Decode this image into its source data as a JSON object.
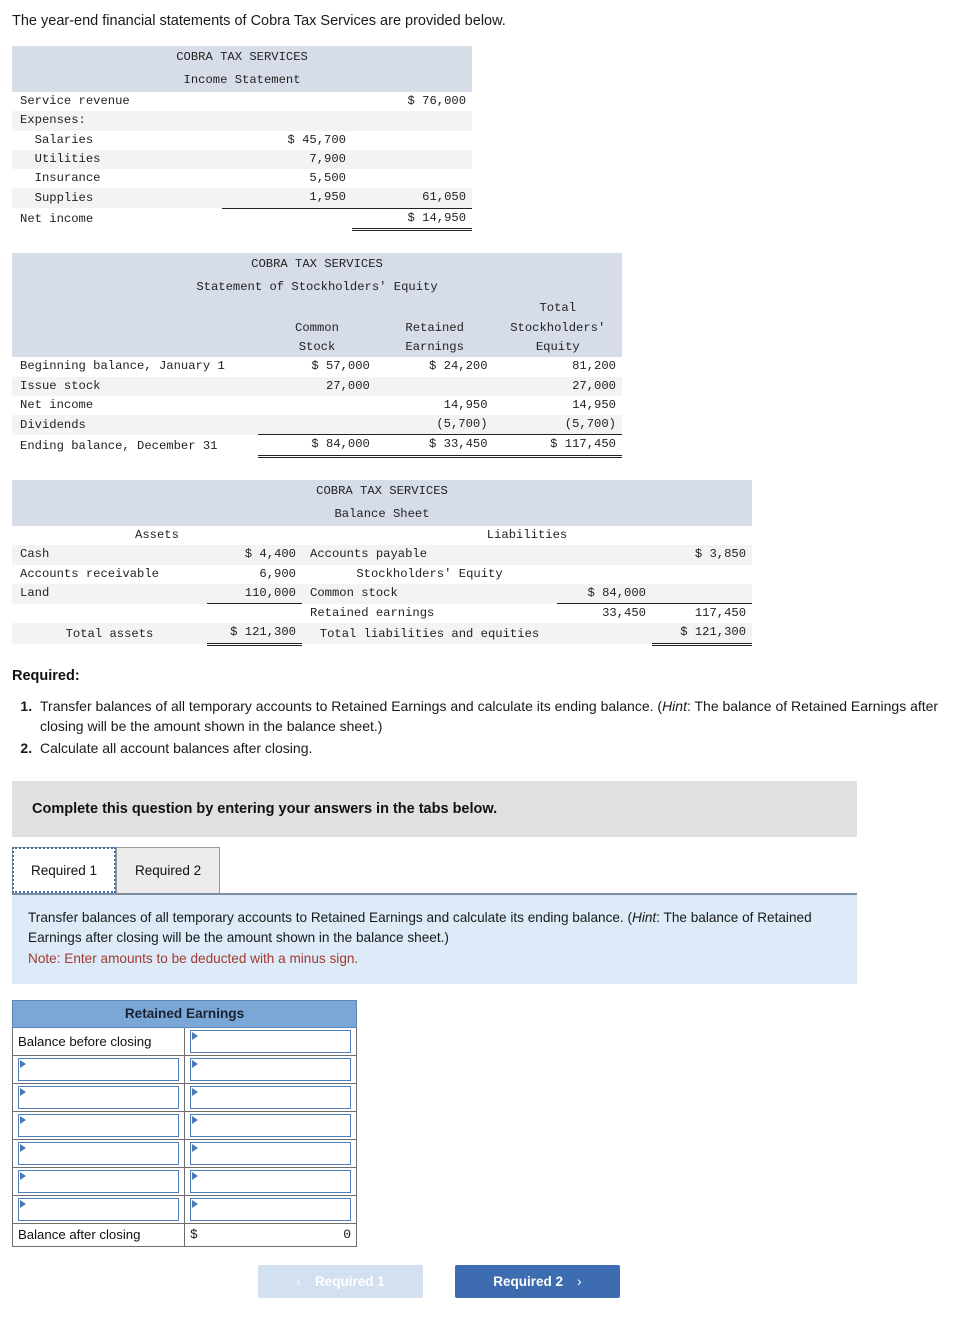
{
  "intro": "The year-end financial statements of Cobra Tax Services are provided below.",
  "income_statement": {
    "company": "COBRA TAX SERVICES",
    "title": "Income Statement",
    "rows": [
      {
        "label": "Service revenue",
        "col1": "",
        "col2": "$ 76,000"
      },
      {
        "label": "Expenses:",
        "col1": "",
        "col2": ""
      },
      {
        "label": "  Salaries",
        "col1": "$ 45,700",
        "col2": ""
      },
      {
        "label": "  Utilities",
        "col1": "7,900",
        "col2": ""
      },
      {
        "label": "  Insurance",
        "col1": "5,500",
        "col2": ""
      },
      {
        "label": "  Supplies",
        "col1": "1,950",
        "col2": "61,050"
      },
      {
        "label": "Net income",
        "col1": "",
        "col2": "$ 14,950"
      }
    ]
  },
  "equity_statement": {
    "company": "COBRA TAX SERVICES",
    "title": "Statement of Stockholders' Equity",
    "col_headers": {
      "total": "Total",
      "common1": "Common",
      "common2": "Stock",
      "retained1": "Retained",
      "retained2": "Earnings",
      "equity1": "Stockholders'",
      "equity2": "Equity"
    },
    "rows": [
      {
        "label": "Beginning balance, January 1",
        "common": "$ 57,000",
        "retained": "$ 24,200",
        "total": "81,200"
      },
      {
        "label": "Issue stock",
        "common": "27,000",
        "retained": "",
        "total": "27,000"
      },
      {
        "label": "Net income",
        "common": "",
        "retained": "14,950",
        "total": "14,950"
      },
      {
        "label": "Dividends",
        "common": "",
        "retained": "(5,700)",
        "total": "(5,700)"
      },
      {
        "label": "Ending balance, December 31",
        "common": "$ 84,000",
        "retained": "$ 33,450",
        "total": "$ 117,450"
      }
    ]
  },
  "balance_sheet": {
    "company": "COBRA TAX SERVICES",
    "title": "Balance Sheet",
    "assets_header": "Assets",
    "liabilities_header": "Liabilities",
    "equity_header": "Stockholders' Equity",
    "rows": [
      {
        "asset_label": "Cash",
        "asset_amt": "$ 4,400",
        "liab_label": "Accounts payable",
        "liab_amt1": "",
        "liab_amt2": "$ 3,850"
      },
      {
        "asset_label": "Accounts receivable",
        "asset_amt": "6,900",
        "liab_label": "",
        "liab_amt1": "",
        "liab_amt2": ""
      },
      {
        "asset_label": "Land",
        "asset_amt": "110,000",
        "liab_label": "Common stock",
        "liab_amt1": "$ 84,000",
        "liab_amt2": ""
      },
      {
        "asset_label": "",
        "asset_amt": "",
        "liab_label": "Retained earnings",
        "liab_amt1": "33,450",
        "liab_amt2": "117,450"
      },
      {
        "asset_label": "Total assets",
        "asset_amt": "$ 121,300",
        "liab_label": "Total liabilities and equities",
        "liab_amt1": "",
        "liab_amt2": "$ 121,300"
      }
    ]
  },
  "required": {
    "heading": "Required:",
    "items": [
      {
        "text_before": "Transfer balances of all temporary accounts to Retained Earnings and calculate its ending balance. (",
        "hint": "Hint",
        "text_after": ": The balance of Retained Earnings after closing will be the amount shown in the balance sheet.)"
      },
      {
        "text_before": "Calculate all account balances after closing.",
        "hint": "",
        "text_after": ""
      }
    ]
  },
  "banner": "Complete this question by entering your answers in the tabs below.",
  "tabs": [
    {
      "label": "Required 1",
      "active": true
    },
    {
      "label": "Required 2",
      "active": false
    }
  ],
  "instruction": {
    "text_before": "Transfer balances of all temporary accounts to Retained Earnings and calculate its ending balance. (",
    "hint": "Hint",
    "text_after": ": The balance of Retained Earnings after closing will be the amount shown in the balance sheet.)",
    "note": "Note: Enter amounts to be deducted with a minus sign."
  },
  "answer_table": {
    "header": "Retained Earnings",
    "first_row_label": "Balance before closing",
    "last_row_label": "Balance after closing",
    "last_row_currency": "$",
    "last_row_value": "0",
    "blank_row_count": 6
  },
  "nav": {
    "prev_label": "Required 1",
    "prev_chevron": "‹",
    "next_label": "Required 2",
    "next_chevron": "›"
  },
  "colors": {
    "statement_header_band": "#d6dce8",
    "answer_header_blue": "#7ba7d7",
    "instruction_panel": "#dcebf7",
    "banner_grey": "#e0e0e0",
    "primary_button": "#3d6cb0",
    "disabled_button": "#d3e0f0",
    "note_red": "#a33a33"
  }
}
